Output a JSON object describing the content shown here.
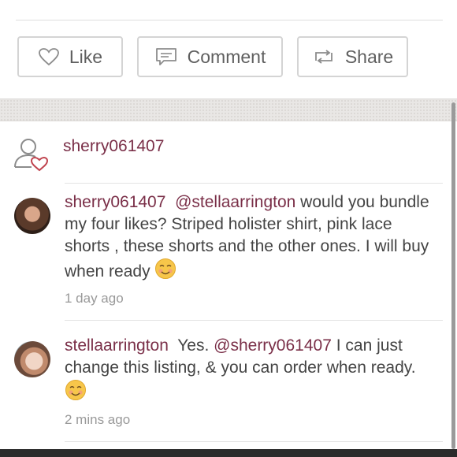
{
  "actions": {
    "like_label": "Like",
    "comment_label": "Comment",
    "share_label": "Share"
  },
  "likers": {
    "icon": "likes-person-heart-icon",
    "username": "sherry061407"
  },
  "comments": [
    {
      "username": "sherry061407",
      "mention": "@stellaarrington",
      "text": "would you bundle my four likes?  Striped holister shirt, pink lace shorts , these shorts and the other ones.  I will buy when ready",
      "emoji": "smiling-face-emoji",
      "timestamp": "1 day ago"
    },
    {
      "username": "stellaarrington",
      "text_before": "Yes.",
      "mention": "@sherry061407",
      "text": "I can just change this listing, & you can order when ready.",
      "emoji": "smiling-face-emoji",
      "timestamp": "2 mins ago"
    }
  ],
  "colors": {
    "username": "#7a2f48",
    "heart_accent": "#c0444f",
    "button_border": "#d4d4d4"
  }
}
